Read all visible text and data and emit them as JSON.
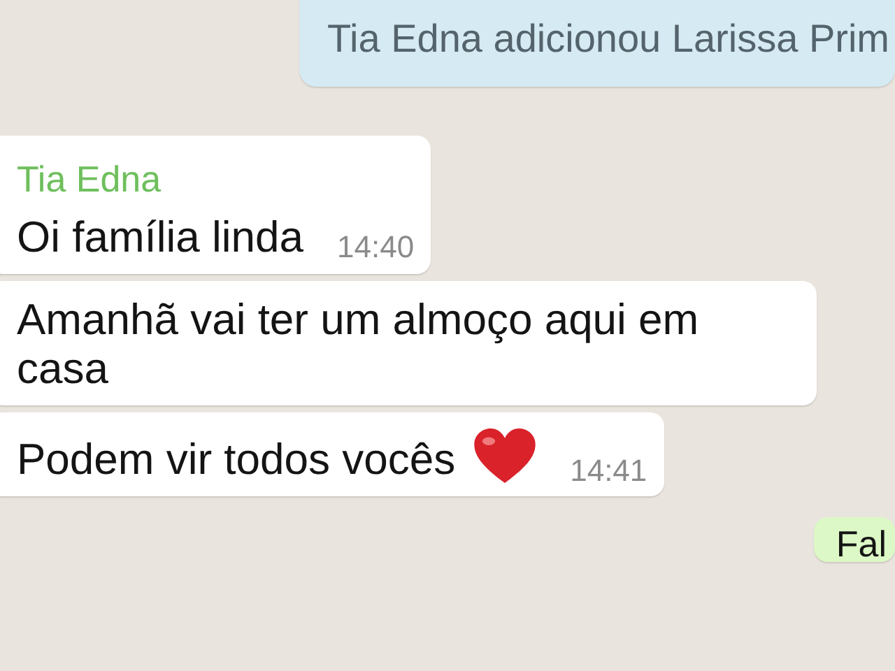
{
  "messages": [
    {
      "kind": "system",
      "text": "Tia Edna adicionou Larissa Prim"
    },
    {
      "kind": "incoming",
      "sender": "Tia Edna",
      "text": "Oi família linda",
      "time": "14:40"
    },
    {
      "kind": "incoming",
      "text": "Amanhã vai ter um almoço aqui em casa"
    },
    {
      "kind": "incoming",
      "text": "Podem vir todos vocês",
      "heart": true,
      "time": "14:41"
    },
    {
      "kind": "outgoing",
      "text": "Fal"
    }
  ]
}
